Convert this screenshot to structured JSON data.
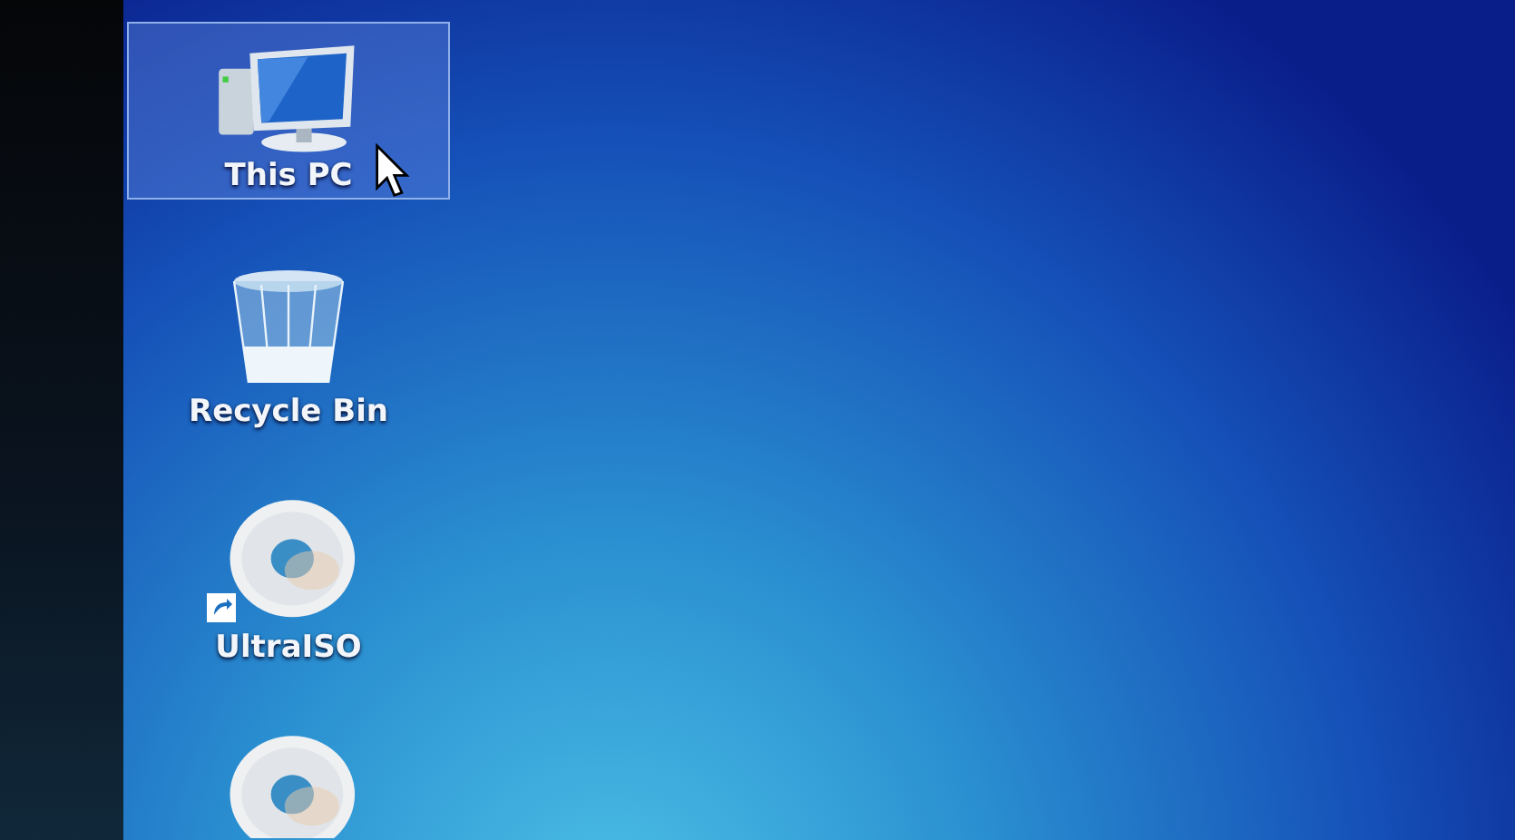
{
  "desktop_icons": [
    {
      "kind": "computer",
      "label": "This PC",
      "selected": true,
      "shortcut": false
    },
    {
      "kind": "bin",
      "label": "Recycle Bin",
      "selected": false,
      "shortcut": false
    },
    {
      "kind": "disc",
      "label": "UltraISO",
      "selected": false,
      "shortcut": true
    },
    {
      "kind": "disc",
      "selected": false,
      "shortcut": false
    }
  ]
}
